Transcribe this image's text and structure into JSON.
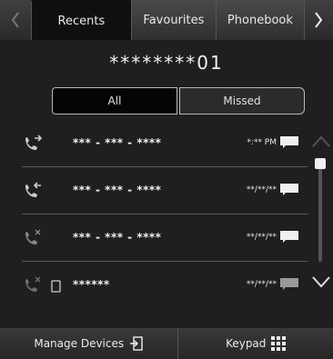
{
  "tabs": {
    "recents": "Recents",
    "favourites": "Favourites",
    "phonebook": "Phonebook"
  },
  "header": {
    "number": "********01"
  },
  "filter": {
    "all": "All",
    "missed": "Missed"
  },
  "calls": [
    {
      "type": "outgoing",
      "number": "*** - *** - ****",
      "time": "*:** PM",
      "device": false
    },
    {
      "type": "incoming",
      "number": "*** - *** - ****",
      "time": "**/**/**",
      "device": false
    },
    {
      "type": "missed",
      "number": "*** - *** - ****",
      "time": "**/**/**",
      "device": false
    },
    {
      "type": "missed",
      "number": "******",
      "time": "**/**/**",
      "device": true
    }
  ],
  "bottom": {
    "manage_devices": "Manage Devices",
    "keypad": "Keypad"
  },
  "colors": {
    "background": "#1f1f1f",
    "active_tab": "#0f0f0f",
    "divider": "#5a5a5a"
  },
  "icons": {
    "outgoing": "outgoing-call-icon",
    "incoming": "incoming-call-icon",
    "missed": "missed-call-icon",
    "message": "message-icon",
    "device": "phone-device-icon",
    "manage": "manage-devices-icon",
    "keypad": "keypad-icon"
  }
}
